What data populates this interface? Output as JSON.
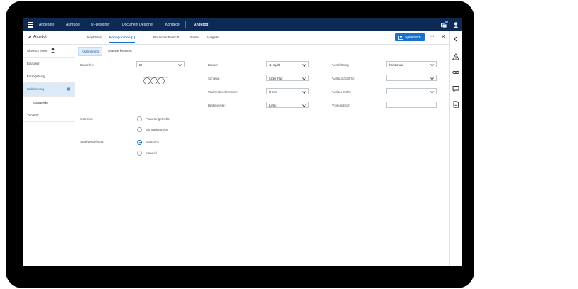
{
  "topbar": {
    "nav": [
      "Angebote",
      "Aufträge",
      "UI-Designer",
      "Document Designer",
      "Kontakte"
    ],
    "current": "Angebot",
    "icons": [
      "menu-icon",
      "notifications-icon",
      "user-icon"
    ]
  },
  "tabsbar": {
    "crumb": "Angebot",
    "tabs": [
      "Kopfdaten",
      "Konfiguration (1)",
      "Positionsübersicht",
      "Preise",
      "Ausgabe"
    ],
    "save_label": "Speichern",
    "more_label": "•••",
    "close_label": "✕"
  },
  "sidebar": {
    "items": [
      "SheetEx therm",
      "Extrusion",
      "Formgebung",
      "Kalibrierung",
      "Glättwerks",
      "Zubehör"
    ]
  },
  "subtabs": [
    "Kalibrierung",
    "Glättwerkssetten"
  ],
  "form": {
    "baureihe_label": "Baureihe:",
    "baureihe_value": "BI",
    "getriebe_label": "Getriebe:",
    "getriebe_options": [
      "Planetengetriebe",
      "Stirnradgetriebe"
    ],
    "spaltverstellung_label": "Spaltverstellung:",
    "spaltverstellung_options": [
      "elektrisch",
      "manuell"
    ],
    "spaltverstellung_selected": "elektrisch",
    "middle": [
      {
        "label": "Bauart:",
        "value": "1. Spalt"
      },
      {
        "label": "Schiene:",
        "value": "Uber Flur"
      },
      {
        "label": "Walzendurchmesser:",
        "value": "0 mm"
      },
      {
        "label": "Bedienseite:",
        "value": "Links"
      }
    ],
    "right": [
      {
        "label": "Ausrichtung:",
        "value": "horizontal"
      },
      {
        "label": "Auslauf/Zuführe:",
        "value": ""
      },
      {
        "label": "Auslauf Höhe:",
        "value": ""
      },
      {
        "label": "Prozesskraft:",
        "value": ""
      }
    ]
  },
  "colors": {
    "topbar": "#0d2a55",
    "accent": "#1a73c8",
    "active_bg": "#dce9f7"
  }
}
